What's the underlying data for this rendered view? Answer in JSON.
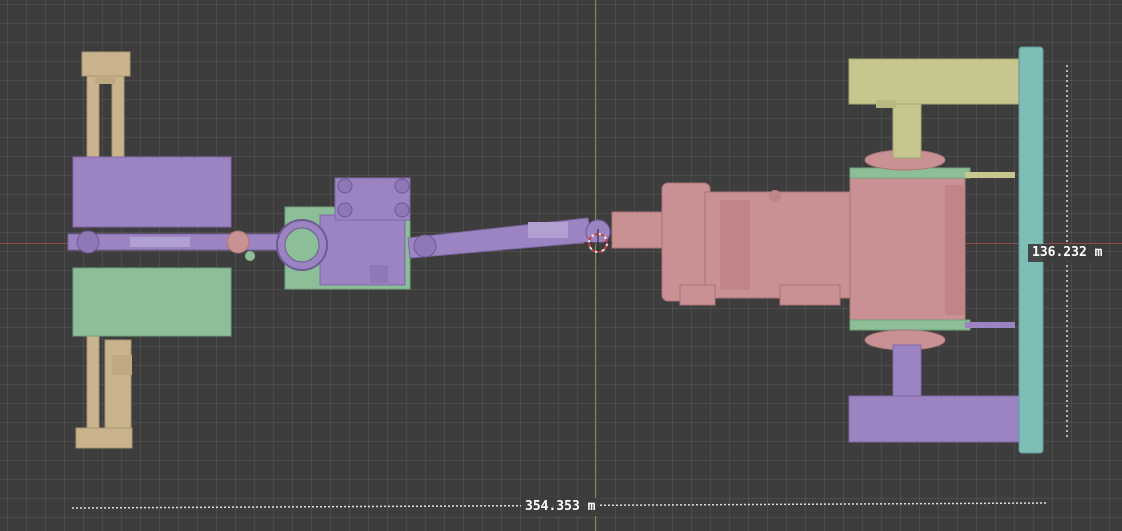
{
  "viewport": {
    "measurements": {
      "width_label": "354.353 m",
      "height_label": "136.232 m"
    },
    "colors": {
      "background": "#3d3d3d",
      "x_axis": "#a24b4e",
      "y_axis": "#7a9c3a",
      "part_tan": "#c9b48e",
      "part_purple": "#9c84c2",
      "part_green": "#8cbf98",
      "part_pink": "#c99193",
      "part_olive": "#c6c68e",
      "part_teal": "#7fbdb7"
    },
    "objects": [
      "front-axle",
      "front-wheel-top",
      "front-wheel-bottom",
      "front-driveshaft",
      "transfer-case",
      "rear-driveshaft",
      "transmission",
      "rear-axle",
      "rear-wheel-top",
      "rear-wheel-bottom",
      "rear-axle-beam",
      "3d-cursor"
    ]
  }
}
